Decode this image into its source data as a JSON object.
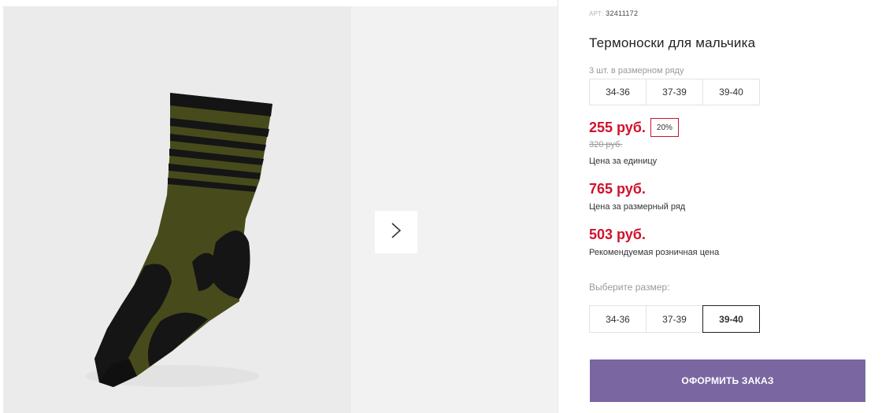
{
  "product": {
    "sku_label": "АРТ:",
    "sku_value": "32411172",
    "title": "Термоноски для мальчика"
  },
  "size_row": {
    "caption": "3 шт. в размерном ряду",
    "sizes": [
      "34-36",
      "37-39",
      "39-40"
    ]
  },
  "pricing": {
    "unit_price": "255 руб.",
    "discount_badge": "20%",
    "old_price": "320 руб.",
    "unit_caption": "Цена за единицу",
    "row_price": "765 руб.",
    "row_caption": "Цена за размерный ряд",
    "retail_price": "503 руб.",
    "retail_caption": "Рекомендуемая розничная цена"
  },
  "size_picker": {
    "label": "Выберите размер:",
    "options": [
      "34-36",
      "37-39",
      "39-40"
    ],
    "selected": "39-40"
  },
  "actions": {
    "order_label": "ОФОРМИТЬ ЗАКАЗ"
  },
  "colors": {
    "price_red": "#d0112b",
    "button_purple": "#7a66a1",
    "sock_olive": "#4a4a1e",
    "sock_black": "#161616"
  },
  "icons": {
    "gallery_next": "chevron-right-icon"
  }
}
